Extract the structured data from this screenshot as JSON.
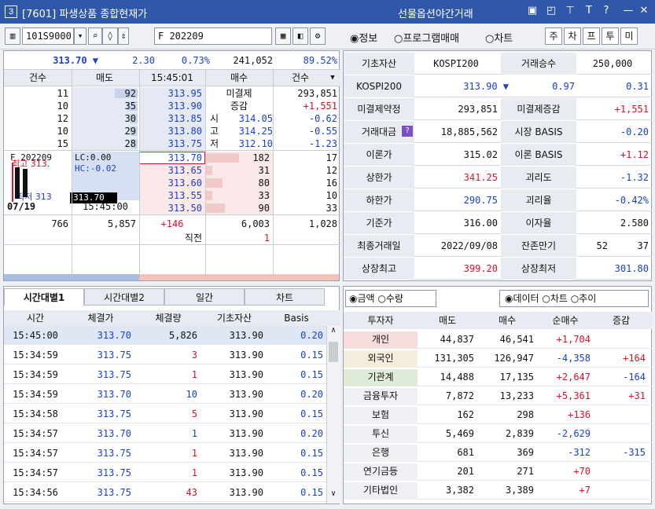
{
  "title": {
    "badge": "3",
    "text": "[7601] 파생상품 종합현재가",
    "right": "선물옵션야간거래"
  },
  "toolbar": {
    "code": "101S9000",
    "name": "F 202209",
    "radios": [
      "◉정보",
      "○프로그램매매",
      "○차트"
    ],
    "keys": [
      "주",
      "차",
      "프",
      "투",
      "미"
    ]
  },
  "summary": {
    "price": "313.70 ▼",
    "change": "2.30",
    "pct": "0.73%",
    "volume": "241,052",
    "ratio": "89.52%"
  },
  "ob_head": [
    "건수",
    "매도",
    "15:45:01",
    "매수",
    "건수"
  ],
  "asks": [
    {
      "cnt": "11",
      "qty": "92",
      "price": "313.95",
      "label": "미결제",
      "val": "293,851",
      "valc": "dk",
      "bar": 0.35
    },
    {
      "cnt": "10",
      "qty": "35",
      "price": "313.90",
      "label": "증감",
      "val": "+1,551",
      "valc": "red",
      "bar": 0.15
    },
    {
      "cnt": "12",
      "qty": "30",
      "price": "313.85",
      "label": "시",
      "val": "314.05",
      "chg": "-0.62",
      "bar": 0.12
    },
    {
      "cnt": "10",
      "qty": "29",
      "price": "313.80",
      "label": "고",
      "val": "314.25",
      "chg": "-0.55",
      "bar": 0.12
    },
    {
      "cnt": "15",
      "qty": "28",
      "price": "313.75",
      "label": "저",
      "val": "312.10",
      "chg": "-1.23",
      "bar": 0.11
    }
  ],
  "mini": {
    "code": "F 202209",
    "lc": "LC:0.00",
    "hc": "HC:-0.02",
    "high": "최고 313.",
    "low": "최저 313",
    "cur": "313.70",
    "date": "07/19",
    "time": "15:45:00"
  },
  "bids": [
    {
      "price": "313.70",
      "qty": "182",
      "cnt": "17",
      "bar": 0.5
    },
    {
      "price": "313.65",
      "qty": "31",
      "cnt": "12",
      "bar": 0.1
    },
    {
      "price": "313.60",
      "qty": "80",
      "cnt": "16",
      "bar": 0.25
    },
    {
      "price": "313.55",
      "qty": "33",
      "cnt": "10",
      "bar": 0.1
    },
    {
      "price": "313.50",
      "qty": "90",
      "cnt": "33",
      "bar": 0.28
    }
  ],
  "ob_total": {
    "askcnt": "766",
    "askqty": "5,857",
    "diff": "+146",
    "bidqty": "6,003",
    "bidcnt": "1,028"
  },
  "ob_last": {
    "label": "직전",
    "val": "1"
  },
  "info": [
    {
      "k1": "기초자산",
      "v1": "KOSPI200",
      "k2": "거래승수",
      "v2": "250,000"
    },
    {
      "k1": "KOSPI200",
      "v1": "313.90 ▼",
      "v1b": "0.97",
      "v2": "0.31"
    },
    {
      "k1": "미결제약정",
      "v1": "293,851",
      "k2": "미결제증감",
      "v2": "+1,551"
    },
    {
      "k1": "거래대금",
      "v1": "18,885,562",
      "k2": "시장 BASIS",
      "v2": "-0.20"
    },
    {
      "k1": "이론가",
      "v1": "315.02",
      "k2": "이론 BASIS",
      "v2": "+1.12"
    },
    {
      "k1": "상한가",
      "v1": "341.25",
      "k2": "괴리도",
      "v2": "-1.32"
    },
    {
      "k1": "하한가",
      "v1": "290.75",
      "k2": "괴리율",
      "v2": "-0.42%"
    },
    {
      "k1": "기준가",
      "v1": "316.00",
      "k2": "이자율",
      "v2": "2.580"
    },
    {
      "k1": "최종거래일",
      "v1": "2022/09/08",
      "k2": "잔존만기",
      "v2": "52",
      "v3": "37"
    },
    {
      "k1": "상장최고",
      "v1": "399.20",
      "k2": "상장최저",
      "v2": "301.80"
    }
  ],
  "tabs": [
    "시간대별1",
    "시간대별2",
    "일간",
    "차트"
  ],
  "tick_head": [
    "시간",
    "체결가",
    "체결량",
    "기초자산",
    "Basis"
  ],
  "ticks": [
    [
      "15:45:00",
      "313.70",
      "5,826",
      "313.90",
      "0.20",
      "dk"
    ],
    [
      "15:34:59",
      "313.75",
      "3",
      "313.90",
      "0.15",
      "red"
    ],
    [
      "15:34:59",
      "313.75",
      "1",
      "313.90",
      "0.15",
      "red"
    ],
    [
      "15:34:59",
      "313.70",
      "10",
      "313.90",
      "0.20",
      "blue"
    ],
    [
      "15:34:58",
      "313.75",
      "5",
      "313.90",
      "0.15",
      "red"
    ],
    [
      "15:34:57",
      "313.70",
      "1",
      "313.90",
      "0.20",
      "blue"
    ],
    [
      "15:34:57",
      "313.75",
      "1",
      "313.90",
      "0.15",
      "red"
    ],
    [
      "15:34:57",
      "313.75",
      "1",
      "313.90",
      "0.15",
      "red"
    ],
    [
      "15:34:56",
      "313.75",
      "43",
      "313.90",
      "0.15",
      "red"
    ]
  ],
  "inv_opts": {
    "left": "◉금액 ○수량",
    "right": "◉데이터 ○차트 ○추이"
  },
  "inv_head": [
    "투자자",
    "매도",
    "매수",
    "순매수",
    "증감"
  ],
  "investors": [
    [
      "개인",
      "44,837",
      "46,541",
      "+1,704",
      ""
    ],
    [
      "외국인",
      "131,305",
      "126,947",
      "-4,358",
      "+164"
    ],
    [
      "기관계",
      "14,488",
      "17,135",
      "+2,647",
      "-164"
    ],
    [
      "금융투자",
      "7,872",
      "13,233",
      "+5,361",
      "+31"
    ],
    [
      "보험",
      "162",
      "298",
      "+136",
      ""
    ],
    [
      "투신",
      "5,469",
      "2,839",
      "-2,629",
      ""
    ],
    [
      "은행",
      "681",
      "369",
      "-312",
      "-315"
    ],
    [
      "연기금등",
      "201",
      "271",
      "+70",
      ""
    ],
    [
      "기타법인",
      "3,382",
      "3,389",
      "+7",
      ""
    ]
  ]
}
